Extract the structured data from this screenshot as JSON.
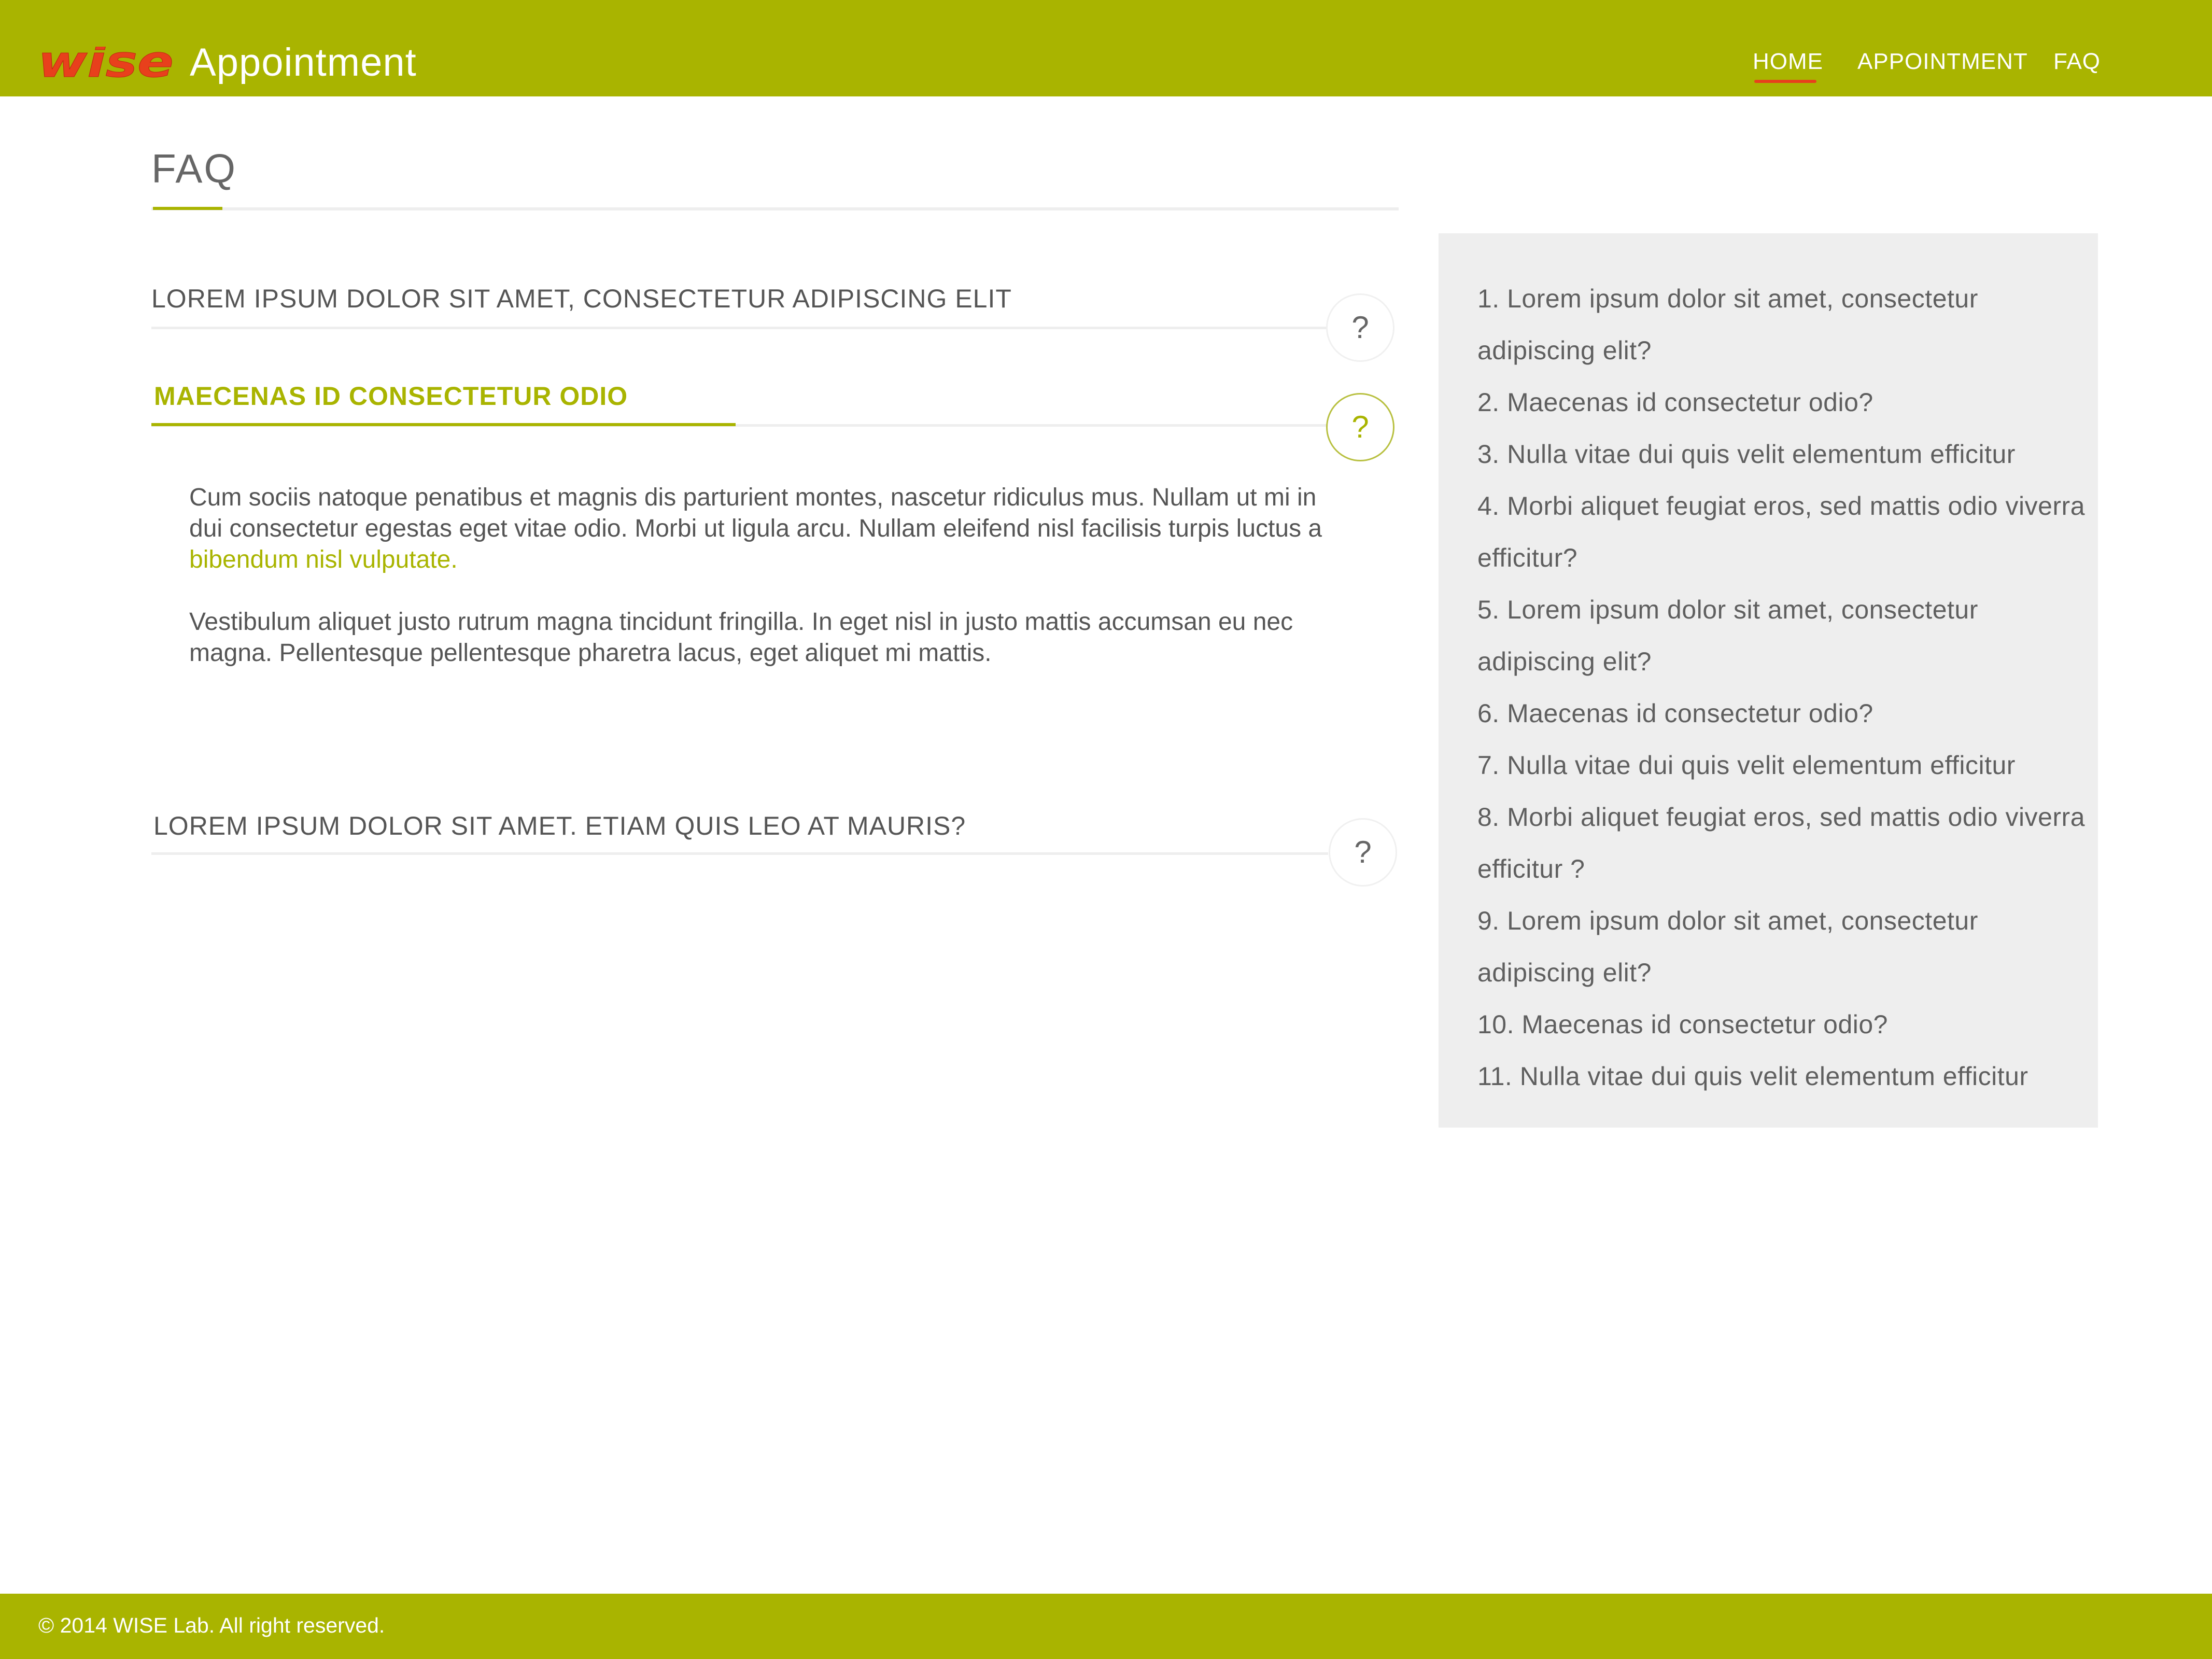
{
  "header": {
    "logo_text": "wise",
    "app_title": "Appointment",
    "nav": {
      "home": "HOME",
      "appointment": "APPOINTMENT",
      "faq": "FAQ"
    },
    "active_nav": "HOME"
  },
  "main": {
    "page_title": "FAQ",
    "faq_items": [
      {
        "question": "LOREM IPSUM DOLOR SIT AMET, CONSECTETUR ADIPISCING ELIT",
        "icon_label": "?",
        "expanded": false
      },
      {
        "question": "MAECENAS ID CONSECTETUR ODIO",
        "icon_label": "?",
        "expanded": true,
        "answer": {
          "p1_text": "Cum sociis natoque penatibus et magnis dis parturient montes, nascetur ridiculus mus. Nullam ut mi in dui consectetur egestas eget vitae odio. Morbi ut ligula arcu. Nullam eleifend nisl facilisis turpis luctus a ",
          "p1_link": "bibendum nisl vulputate.",
          "p2": "Vestibulum aliquet justo rutrum magna tincidunt fringilla. In eget nisl in justo mattis accumsan eu nec magna. Pellentesque pellentesque pharetra lacus, eget aliquet mi mattis."
        }
      },
      {
        "question": "LOREM IPSUM DOLOR SIT AMET. ETIAM QUIS LEO AT MAURIS?",
        "icon_label": "?",
        "expanded": false
      }
    ]
  },
  "sidebar": {
    "items": [
      "1. Lorem ipsum dolor sit amet, consectetur adipiscing elit?",
      "2. Maecenas id consectetur odio?",
      "3. Nulla vitae dui quis velit elementum efficitur",
      "4. Morbi aliquet feugiat eros, sed mattis odio viverra efficitur?",
      "5. Lorem ipsum dolor sit amet, consectetur adipiscing elit?",
      "6. Maecenas id consectetur odio?",
      "7. Nulla vitae dui quis velit elementum efficitur",
      "8. Morbi aliquet feugiat eros, sed mattis odio viverra efficitur ?",
      "9. Lorem ipsum dolor sit amet, consectetur adipiscing elit?",
      "10. Maecenas id consectetur odio?",
      "11. Nulla vitae dui quis velit elementum efficitur"
    ]
  },
  "footer": {
    "text": "© 2014 WISE Lab. All right reserved."
  },
  "colors": {
    "brand": "#a9b400",
    "logo_red": "#e8401c",
    "text": "#555555",
    "panel": "#eeeeee"
  }
}
